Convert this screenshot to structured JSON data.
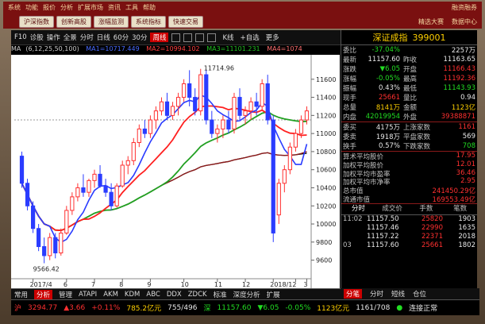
{
  "app": {
    "menu": [
      "系统",
      "功能",
      "报价",
      "分析",
      "扩展市场",
      "资讯",
      "工具",
      "帮助"
    ],
    "menu_right": "融资融券",
    "toolbar_buttons": [
      "沪深指数",
      "创新高股",
      "涨幅监测",
      "系统指标",
      "快速交易"
    ],
    "toolbar_right": [
      "精选大赛",
      "数据中心"
    ]
  },
  "chart_toolbar": {
    "items": [
      "F10",
      "诊股",
      "操作",
      "全景",
      "分时",
      "日线",
      "60分",
      "30分",
      "周线"
    ],
    "active": "周线",
    "right_items": [
      "K线",
      "+自选",
      "更多"
    ]
  },
  "ma": {
    "label": "MA",
    "params": "(6,12,25,50,100)",
    "ma1": "MA1=10717.449",
    "ma2": "MA2=10994.102",
    "ma3": "MA3=11101.231",
    "ma4": "MA4=1074"
  },
  "colors": {
    "ma1": "#2a3cff",
    "ma2": "#ff2020",
    "ma3": "#22a022",
    "ma4": "#8b1a1a",
    "ma5": "#000000",
    "up": "#ff3030",
    "down": "#2a3cff"
  },
  "chart_data": {
    "type": "candlestick",
    "y_ticks": [
      9600,
      9800,
      10000,
      10200,
      10400,
      10600,
      10800,
      11000,
      11200,
      11400,
      11600
    ],
    "ylim": [
      9500,
      11800
    ],
    "x_ticks": [
      "2017/4",
      "6",
      "7",
      "8",
      "9",
      "10",
      "11",
      "12",
      "2018/1",
      "2",
      "3"
    ],
    "annotations": {
      "high": "11714.96",
      "low": "9566.42"
    },
    "candles": [
      {
        "o": 10750,
        "h": 10800,
        "l": 10400,
        "c": 10450
      },
      {
        "o": 10450,
        "h": 10500,
        "l": 10150,
        "c": 10200
      },
      {
        "o": 10200,
        "h": 10250,
        "l": 9900,
        "c": 9950
      },
      {
        "o": 9950,
        "h": 10000,
        "l": 9700,
        "c": 9750
      },
      {
        "o": 9750,
        "h": 9850,
        "l": 9566,
        "c": 9650
      },
      {
        "o": 9650,
        "h": 9900,
        "l": 9600,
        "c": 9850
      },
      {
        "o": 9850,
        "h": 9900,
        "l": 9620,
        "c": 9680
      },
      {
        "o": 9680,
        "h": 9950,
        "l": 9650,
        "c": 9900
      },
      {
        "o": 9900,
        "h": 10200,
        "l": 9880,
        "c": 10150
      },
      {
        "o": 10150,
        "h": 10350,
        "l": 10100,
        "c": 10300
      },
      {
        "o": 10300,
        "h": 10450,
        "l": 10250,
        "c": 10400
      },
      {
        "o": 10400,
        "h": 10550,
        "l": 10300,
        "c": 10350
      },
      {
        "o": 10350,
        "h": 10500,
        "l": 10300,
        "c": 10480
      },
      {
        "o": 10480,
        "h": 10600,
        "l": 10400,
        "c": 10550
      },
      {
        "o": 10550,
        "h": 10650,
        "l": 10400,
        "c": 10420
      },
      {
        "o": 10420,
        "h": 10500,
        "l": 10300,
        "c": 10350
      },
      {
        "o": 10350,
        "h": 10450,
        "l": 10150,
        "c": 10200
      },
      {
        "o": 10200,
        "h": 10450,
        "l": 10180,
        "c": 10420
      },
      {
        "o": 10420,
        "h": 10700,
        "l": 10400,
        "c": 10650
      },
      {
        "o": 10650,
        "h": 10750,
        "l": 10550,
        "c": 10700
      },
      {
        "o": 10700,
        "h": 10950,
        "l": 10650,
        "c": 10900
      },
      {
        "o": 10900,
        "h": 11100,
        "l": 10850,
        "c": 11050
      },
      {
        "o": 11050,
        "h": 11150,
        "l": 10950,
        "c": 11000
      },
      {
        "o": 11000,
        "h": 11200,
        "l": 10950,
        "c": 11150
      },
      {
        "o": 11150,
        "h": 11300,
        "l": 11050,
        "c": 11250
      },
      {
        "o": 11250,
        "h": 11400,
        "l": 11200,
        "c": 11350
      },
      {
        "o": 11350,
        "h": 11450,
        "l": 11150,
        "c": 11200
      },
      {
        "o": 11200,
        "h": 11350,
        "l": 11150,
        "c": 11300
      },
      {
        "o": 11300,
        "h": 11450,
        "l": 11200,
        "c": 11400
      },
      {
        "o": 11400,
        "h": 11600,
        "l": 11350,
        "c": 11550
      },
      {
        "o": 11550,
        "h": 11700,
        "l": 11300,
        "c": 11400
      },
      {
        "o": 11400,
        "h": 11500,
        "l": 11200,
        "c": 11250
      },
      {
        "o": 11250,
        "h": 11715,
        "l": 11200,
        "c": 11650
      },
      {
        "o": 11650,
        "h": 11700,
        "l": 11100,
        "c": 11150
      },
      {
        "o": 11150,
        "h": 11250,
        "l": 10950,
        "c": 11000
      },
      {
        "o": 11000,
        "h": 11100,
        "l": 10900,
        "c": 11050
      },
      {
        "o": 11050,
        "h": 11200,
        "l": 10950,
        "c": 11150
      },
      {
        "o": 11150,
        "h": 11250,
        "l": 11000,
        "c": 11050
      },
      {
        "o": 11050,
        "h": 11450,
        "l": 11000,
        "c": 11400
      },
      {
        "o": 11400,
        "h": 11500,
        "l": 11150,
        "c": 11200
      },
      {
        "o": 11200,
        "h": 11300,
        "l": 11100,
        "c": 11250
      },
      {
        "o": 11250,
        "h": 11400,
        "l": 11150,
        "c": 11350
      },
      {
        "o": 11350,
        "h": 11450,
        "l": 11200,
        "c": 11300
      },
      {
        "o": 11300,
        "h": 11600,
        "l": 11250,
        "c": 11550
      },
      {
        "o": 11550,
        "h": 11650,
        "l": 11100,
        "c": 11150
      },
      {
        "o": 11150,
        "h": 11200,
        "l": 9800,
        "c": 9900
      },
      {
        "o": 10100,
        "h": 10500,
        "l": 10000,
        "c": 10450
      },
      {
        "o": 10450,
        "h": 10650,
        "l": 10350,
        "c": 10600
      },
      {
        "o": 10600,
        "h": 10900,
        "l": 10550,
        "c": 10850
      },
      {
        "o": 10850,
        "h": 11050,
        "l": 10800,
        "c": 11000
      },
      {
        "o": 11000,
        "h": 11200,
        "l": 10950,
        "c": 11150
      },
      {
        "o": 11150,
        "h": 11300,
        "l": 11100,
        "c": 11250
      }
    ]
  },
  "quote": {
    "title": "深证成指",
    "code": "399001",
    "rows": [
      {
        "l1": "委比",
        "v1": "-37.04%",
        "c1": "grn",
        "l2": "",
        "v2": "2257万",
        "c2": "wht"
      },
      {
        "l1": "最新",
        "v1": "11157.60",
        "c1": "wht",
        "l2": "昨收",
        "v2": "11163.65",
        "c2": "wht"
      },
      {
        "l1": "涨跌",
        "v1": "▼6.05",
        "c1": "grn",
        "l2": "开盘",
        "v2": "11166.43",
        "c2": "red"
      },
      {
        "l1": "涨幅",
        "v1": "-0.05%",
        "c1": "grn",
        "l2": "最高",
        "v2": "11192.36",
        "c2": "red"
      },
      {
        "l1": "振幅",
        "v1": "0.43%",
        "c1": "wht",
        "l2": "最低",
        "v2": "11143.93",
        "c2": "grn"
      },
      {
        "l1": "现手",
        "v1": "25661",
        "c1": "red",
        "l2": "量比",
        "v2": "0.94",
        "c2": "wht"
      },
      {
        "l1": "总量",
        "v1": "8141万",
        "c1": "yel",
        "l2": "金额",
        "v2": "1123亿",
        "c2": "yel"
      },
      {
        "l1": "内盘",
        "v1": "42019954",
        "c1": "grn",
        "l2": "外盘",
        "v2": "39388871",
        "c2": "red"
      },
      {
        "l1": "委买",
        "v1": "4175万",
        "c1": "wht",
        "l2": "上涨家数",
        "v2": "1161",
        "c2": "red",
        "sep": true
      },
      {
        "l1": "委卖",
        "v1": "1918万",
        "c1": "wht",
        "l2": "平盘家数",
        "v2": "569",
        "c2": "wht"
      },
      {
        "l1": "换手",
        "v1": "0.57%",
        "c1": "wht",
        "l2": "下跌家数",
        "v2": "708",
        "c2": "grn"
      }
    ],
    "stats": [
      {
        "label": "算术平均股价",
        "value": "17.95"
      },
      {
        "label": "加权平均股价",
        "value": "12.01"
      },
      {
        "label": "加权平均市盈率",
        "value": "36.46"
      },
      {
        "label": "加权平均市净率",
        "value": "2.95"
      },
      {
        "label": "总市值",
        "value": "241450.29亿"
      },
      {
        "label": "流通市值",
        "value": "169553.49亿"
      }
    ],
    "tick_tabs": [
      "分时",
      "成交价",
      "手数",
      "笔数"
    ],
    "ticks": [
      {
        "t": "11:02",
        "p": "11157.50",
        "pc": "wht",
        "v": "25820",
        "vc": "red",
        "n": "1903"
      },
      {
        "t": "",
        "p": "11157.46",
        "pc": "wht",
        "v": "22990",
        "vc": "red",
        "n": "1635"
      },
      {
        "t": "",
        "p": "11157.22",
        "pc": "wht",
        "v": "22371",
        "vc": "red",
        "n": "2018"
      },
      {
        "t": "03",
        "p": "11157.60",
        "pc": "wht",
        "v": "25661",
        "vc": "red",
        "n": "1802"
      }
    ]
  },
  "bottom_tabs": {
    "items": [
      "常用",
      "分析",
      "管理",
      "ATAPI",
      "AKM",
      "KDM",
      "ABC",
      "DDX",
      "ZDCK",
      "标准",
      "深度分析",
      "扩展"
    ],
    "active": "分析"
  },
  "panel_tabs": {
    "items": [
      "分笔",
      "分时",
      "短线",
      "仓位"
    ],
    "active": "分笔"
  },
  "status": {
    "sh_label": "沪",
    "sh_value": "3294.77",
    "sh_change": "▲3.66",
    "sh_pct": "+0.11%",
    "sh_amount": "785.2亿元",
    "sz_value": "755/496",
    "sz_label": "深",
    "sz_index": "11157.60",
    "sz_change": "▼6.05",
    "sz_pct": "-0.05%",
    "sz_amount": "1123亿元",
    "ratio": "1161/708",
    "conn": "连接正常"
  }
}
